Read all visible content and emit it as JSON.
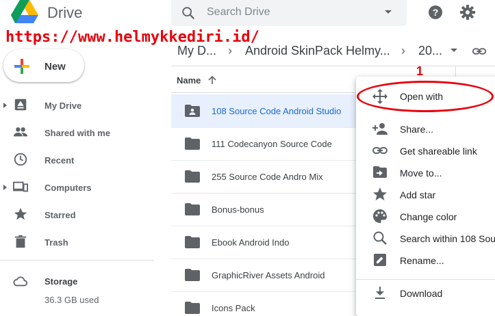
{
  "app": {
    "name": "Drive",
    "watermark": "https://www.helmykkediri.id/"
  },
  "search": {
    "placeholder": "Search Drive"
  },
  "breadcrumb": {
    "root": "My D...",
    "middle": "Android SkinPack Helmy...",
    "current": "20..."
  },
  "new_button": {
    "label": "New"
  },
  "sidebar": {
    "items": [
      {
        "label": "My Drive"
      },
      {
        "label": "Shared with me"
      },
      {
        "label": "Recent"
      },
      {
        "label": "Computers"
      },
      {
        "label": "Starred"
      },
      {
        "label": "Trash"
      }
    ],
    "storage": {
      "label": "Storage",
      "used": "36.3 GB used"
    }
  },
  "file_list": {
    "column_name": "Name",
    "rows": [
      {
        "name": "108 Source Code Android Studio",
        "icon": "shared-folder-icon",
        "selected": true
      },
      {
        "name": "111 Codecanyon Source Code",
        "icon": "folder-icon"
      },
      {
        "name": "255 Source Code Andro Mix",
        "icon": "folder-icon"
      },
      {
        "name": "Bonus-bonus",
        "icon": "folder-icon"
      },
      {
        "name": "Ebook Android Indo",
        "icon": "folder-icon"
      },
      {
        "name": "GraphicRiver Assets Android",
        "icon": "folder-icon"
      },
      {
        "name": "Icons Pack",
        "icon": "folder-icon"
      }
    ]
  },
  "context_menu": {
    "items": [
      {
        "label": "Open with",
        "icon": "move-arrows-icon"
      },
      {
        "label": "Share...",
        "icon": "person-add-icon"
      },
      {
        "label": "Get shareable link",
        "icon": "link-icon"
      },
      {
        "label": "Move to...",
        "icon": "move-folder-icon"
      },
      {
        "label": "Add star",
        "icon": "star-icon"
      },
      {
        "label": "Change color",
        "icon": "palette-icon"
      },
      {
        "label": "Search within 108 Sou",
        "icon": "search-icon"
      },
      {
        "label": "Rename...",
        "icon": "edit-icon"
      },
      {
        "label": "Download",
        "icon": "download-icon"
      }
    ]
  },
  "annotation": {
    "number": "1",
    "color": "#e8000b"
  },
  "colors": {
    "selected_bg": "#e8f0fe",
    "selected_text": "#1967d2",
    "icon_grey": "#5f6368"
  }
}
